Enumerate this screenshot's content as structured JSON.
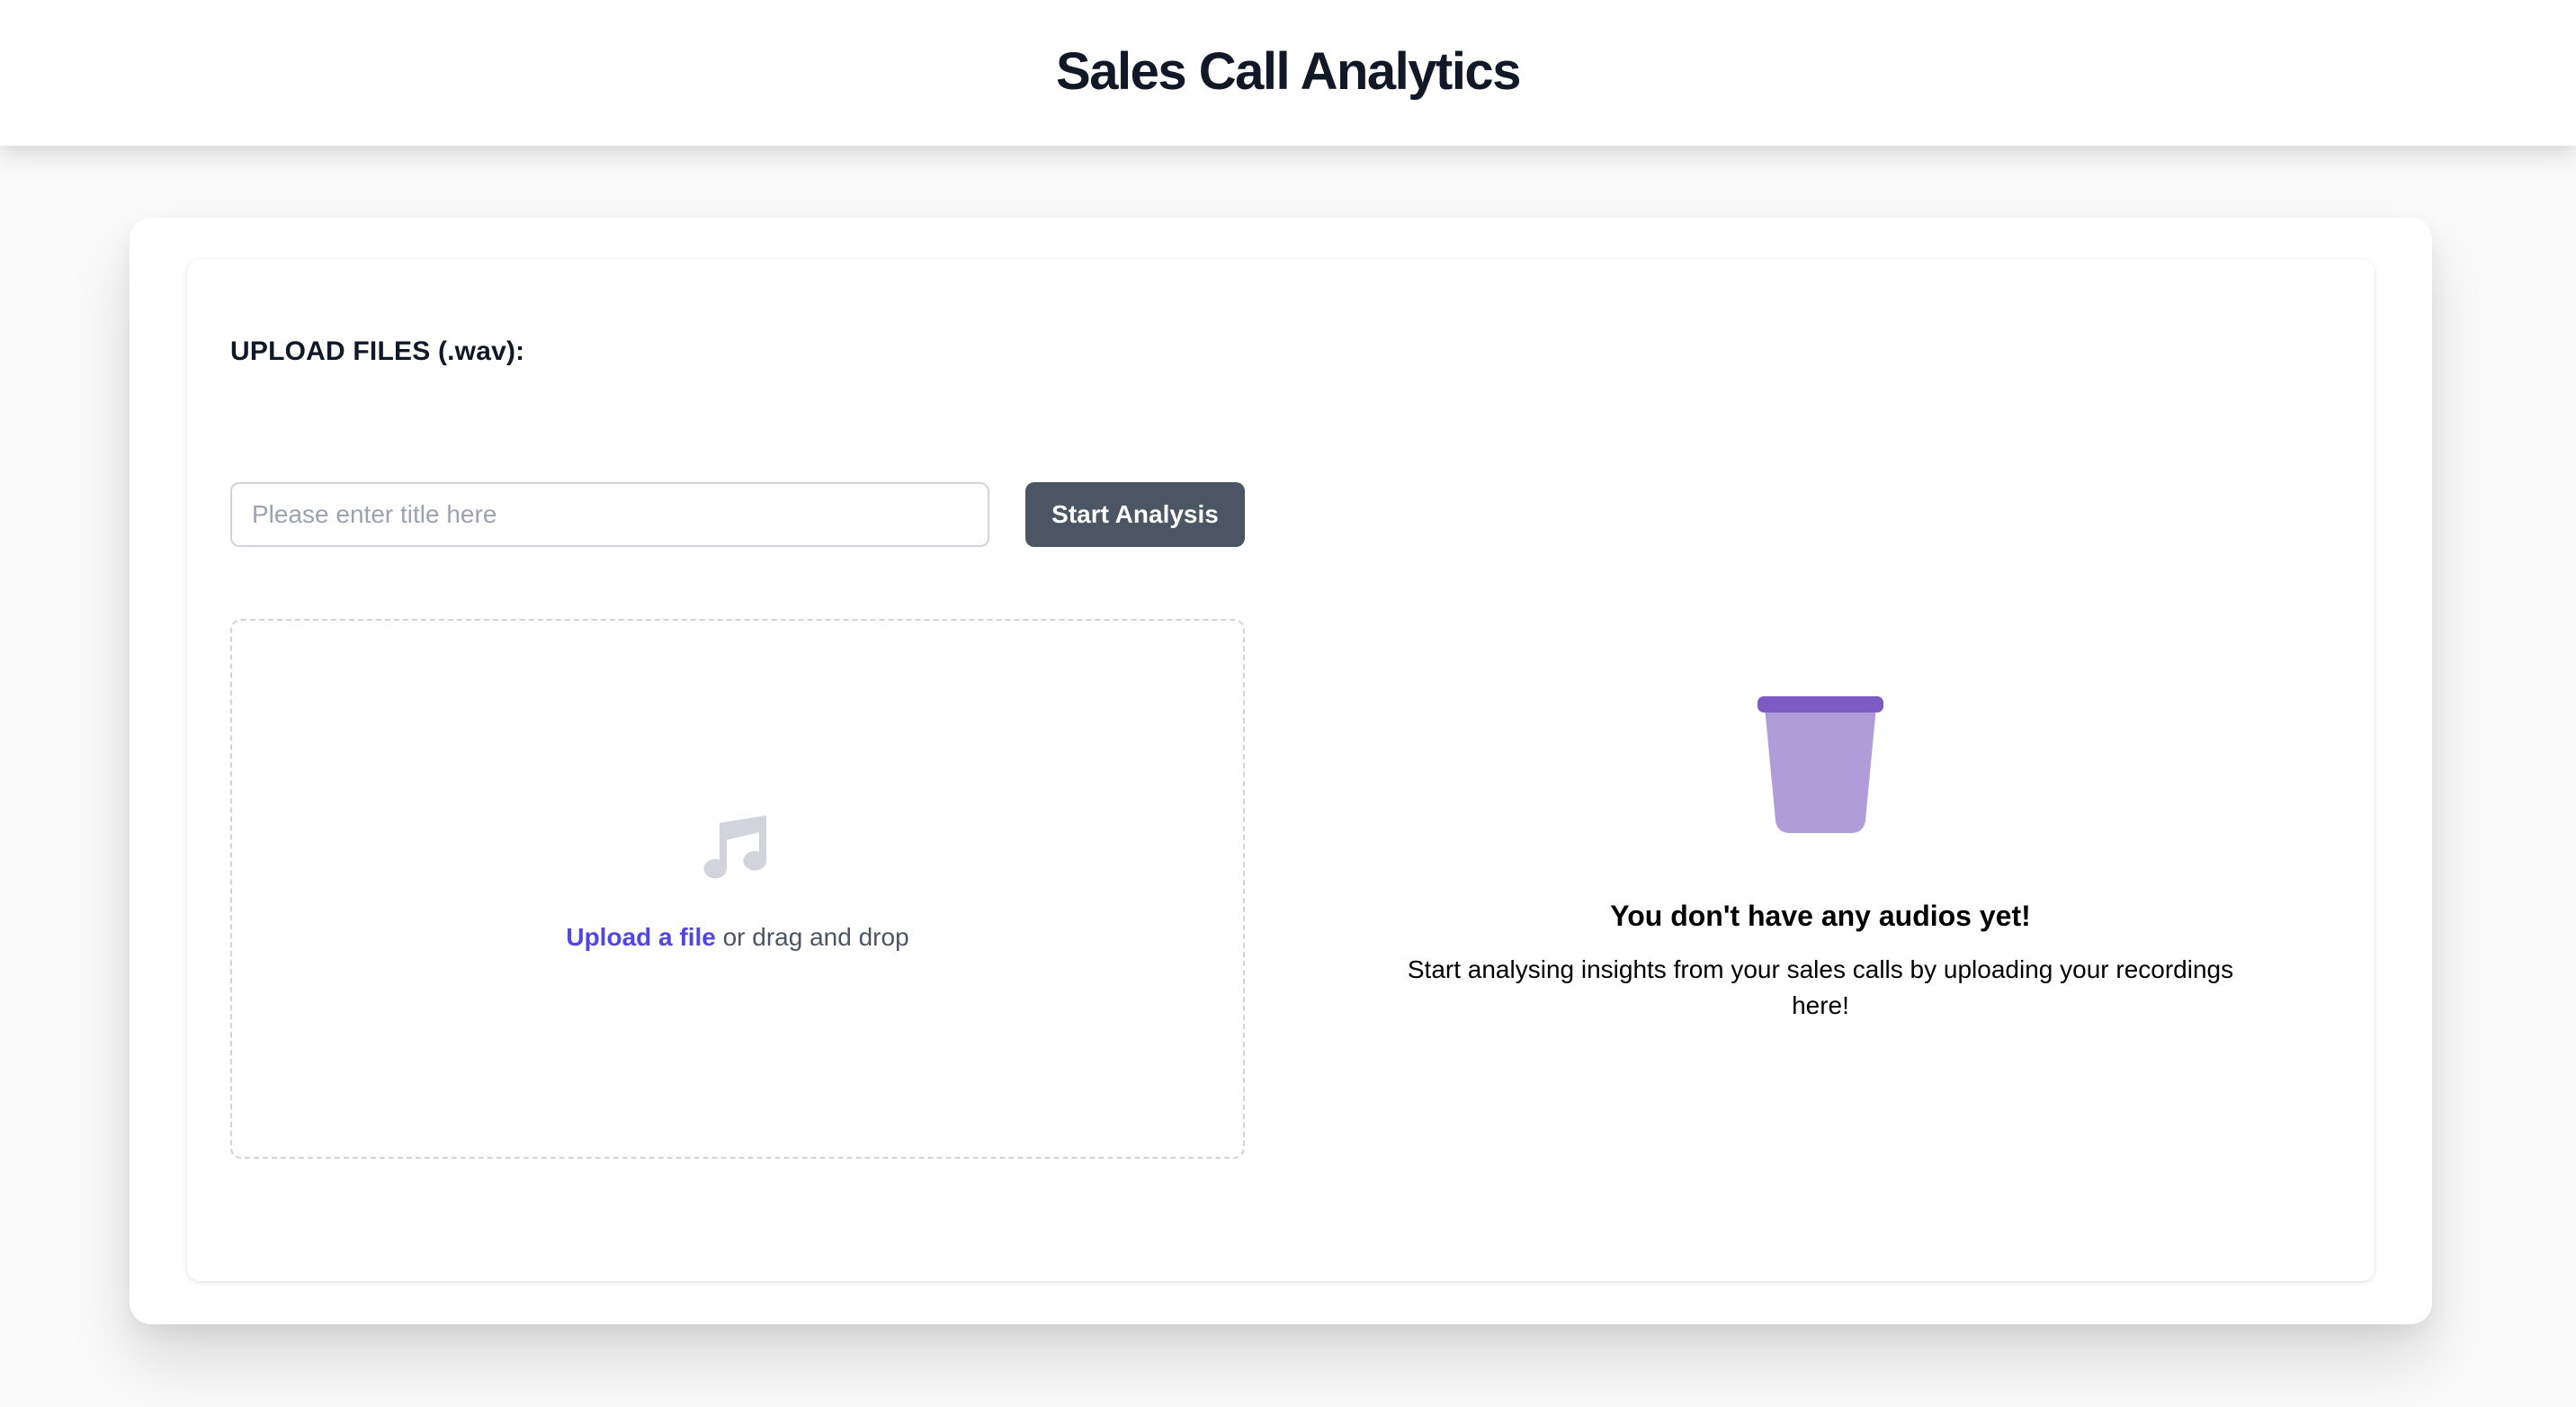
{
  "header": {
    "title": "Sales Call Analytics"
  },
  "upload": {
    "section_label": "UPLOAD FILES (.wav):",
    "title_input": {
      "placeholder": "Please enter title here",
      "value": ""
    },
    "start_button_label": "Start Analysis",
    "dropzone": {
      "icon": "music-note-icon",
      "link_text": "Upload a file",
      "rest_text": " or drag and drop"
    }
  },
  "empty_state": {
    "icon": "trash-bin-icon",
    "title": "You don't have any audios yet!",
    "description": "Start analysing insights from your sales calls by uploading your recordings here!"
  },
  "colors": {
    "accent": "#4f46e5",
    "button_bg": "#4b5563",
    "bin_body": "#b09cd8",
    "bin_rim": "#7c5cc4",
    "icon_gray": "#d1d5db"
  }
}
